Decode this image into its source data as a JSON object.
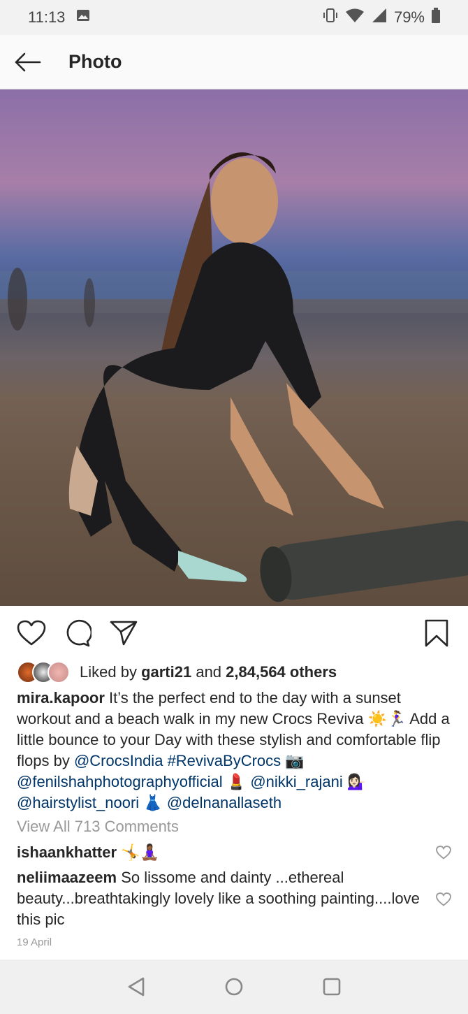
{
  "status": {
    "time": "11:13",
    "battery": "79%",
    "icons": [
      "image-icon",
      "vibrate-icon",
      "wifi-icon",
      "signal-icon",
      "battery-icon"
    ]
  },
  "header": {
    "title": "Photo"
  },
  "post": {
    "likes_prefix": "Liked by ",
    "liked_by": "garti21",
    "likes_and": " and ",
    "likes_count": "2,84,564 others",
    "caption_user": "mira.kapoor",
    "caption_text_1": " It’s the perfect end to the day with a sunset workout and a beach walk in my new Crocs Reviva ",
    "emoji_1": "☀️🏃‍♀️",
    "caption_text_2": " Add a little bounce to your Day with these stylish and comfortable flip flops by ",
    "mention_crocs": "@CrocsIndia",
    "hashtag": "#RevivaByCrocs",
    "emoji_2": "📷",
    "mention_photo": "@fenilshahphotographyofficial",
    "emoji_3": "💄",
    "mention_nikki": "@nikki_rajani",
    "emoji_4": "💁🏻‍♀️",
    "mention_hair": "@hairstylist_noori",
    "emoji_5": "👗",
    "mention_delnan": "@delnanallaseth",
    "view_all": "View All 713 Comments",
    "comments": [
      {
        "user": "ishaankhatter",
        "text": " 🤸🧘🏾‍♀️"
      },
      {
        "user": "neliimaazeem",
        "text": " So lissome and dainty ...ethereal beauty...breathtakingly lovely like a soothing painting....love this pic"
      }
    ],
    "date": "19 April"
  },
  "colors": {
    "link": "#003569",
    "muted": "#999999",
    "text": "#262626"
  }
}
